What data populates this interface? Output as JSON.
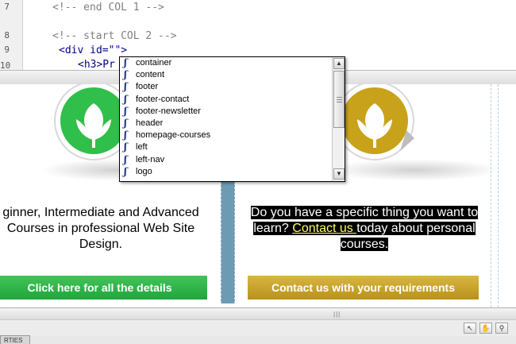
{
  "code_view": {
    "line_numbers": [
      "7",
      "8",
      "9",
      "10"
    ],
    "lines": {
      "comment_end_col1": "<!-- end COL 1 -->",
      "comment_start_col2": "<!-- start COL 2 -->",
      "div_open": "<div id=\"",
      "div_cursor_quote": "\"",
      "div_close": ">",
      "h3_partial": "<h3>Pr"
    }
  },
  "autocomplete": {
    "item_icon_glyph": "ʃ",
    "items": [
      "container",
      "content",
      "footer",
      "footer-contact",
      "footer-newsletter",
      "header",
      "homepage-courses",
      "left",
      "left-nav",
      "logo"
    ]
  },
  "design_view": {
    "col1": {
      "line1": "ginner, Intermediate and Advanced",
      "line2": "Courses in professional Web Site",
      "line3": "Design.",
      "cta": "Click here for all the details",
      "logo_color": "#2fbf4a"
    },
    "col2": {
      "line1": "Do you have a specific thing you want to",
      "line2_pre": "learn? ",
      "line2_link": "Contact us ",
      "line2_post": "today about personal",
      "line3": "courses.",
      "cta": "Contact us with your requirements",
      "logo_color": "#c9a21c"
    }
  },
  "status_bar": {
    "panel_tab": "RTIES"
  },
  "colors": {
    "divider": "#6d9bb4",
    "green_cta": "#2cb446",
    "gold_cta": "#c9a31f",
    "link_highlight": "#ffff66",
    "code_tag": "#00008b"
  }
}
